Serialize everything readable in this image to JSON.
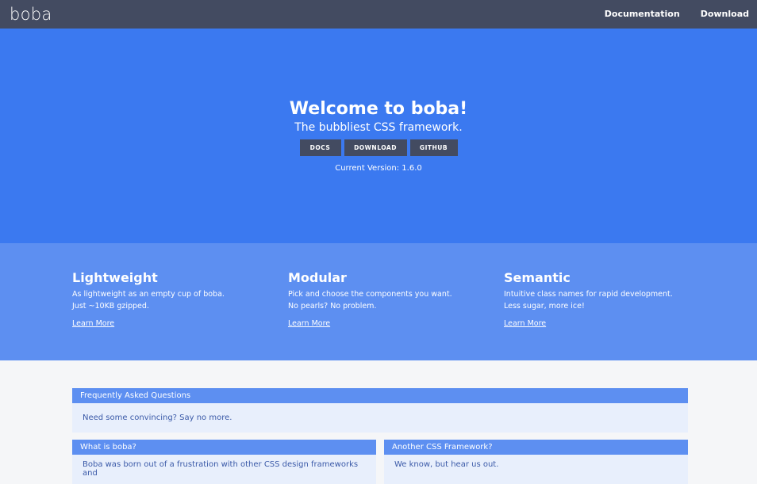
{
  "nav": {
    "brand": "boba",
    "links": [
      "Documentation",
      "Download"
    ]
  },
  "hero": {
    "title": "Welcome to boba!",
    "subtitle": "The bubbliest CSS framework.",
    "buttons": [
      "DOCS",
      "DOWNLOAD",
      "GITHUB"
    ],
    "version": "Current Version: 1.6.0"
  },
  "features": [
    {
      "title": "Lightweight",
      "line1": "As lightweight as an empty cup of boba.",
      "line2": "Just ~10KB gzipped.",
      "link": "Learn More"
    },
    {
      "title": "Modular",
      "line1": "Pick and choose the components you want.",
      "line2": "No pearls? No problem.",
      "link": "Learn More"
    },
    {
      "title": "Semantic",
      "line1": "Intuitive class names for rapid development.",
      "line2": "Less sugar, more ice!",
      "link": "Learn More"
    }
  ],
  "faq": {
    "header": "Frequently Asked Questions",
    "body": "Need some convincing? Say no more."
  },
  "cards": [
    {
      "header": "What is boba?",
      "body": "Boba was born out of a frustration with other CSS design frameworks and"
    },
    {
      "header": "Another CSS Framework?",
      "body": "We know, but hear us out."
    }
  ],
  "colors": {
    "navbar": "#434b61",
    "hero": "#3b79f0",
    "features": "#5d8ff1",
    "card_header": "#5d8ff1",
    "card_body": "#e8effc"
  }
}
